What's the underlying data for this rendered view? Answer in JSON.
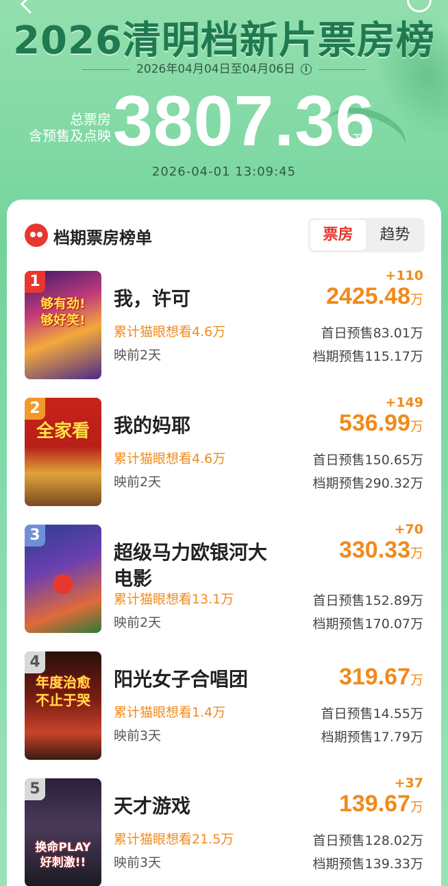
{
  "header": {
    "title": "2026清明档新片票房榜",
    "date_range": "2026年04月04日至04月06日",
    "total_label_line1": "总票房",
    "total_label_line2": "含预售及点映",
    "total_value": "3807.36",
    "total_unit": "万",
    "timestamp": "2026-04-01   13:09:45"
  },
  "section": {
    "title": "档期票房榜单",
    "tabs": [
      {
        "label": "票房",
        "active": true
      },
      {
        "label": "趋势",
        "active": false
      }
    ]
  },
  "movies": [
    {
      "rank": "1",
      "title": "我，许可",
      "want": "累计猫眼想看4.6万",
      "days": "映前2天",
      "delta": "+110",
      "amount": "2425.48",
      "unit": "万",
      "first_day": "首日预售83.01万",
      "period": "档期预售115.17万",
      "poster_text": "够有劲!\n够好笑!"
    },
    {
      "rank": "2",
      "title": "我的妈耶",
      "want": "累计猫眼想看4.6万",
      "days": "映前2天",
      "delta": "+149",
      "amount": "536.99",
      "unit": "万",
      "first_day": "首日预售150.65万",
      "period": "档期预售290.32万",
      "poster_text": "全家看"
    },
    {
      "rank": "3",
      "title": "超级马力欧银河大电影",
      "want": "累计猫眼想看13.1万",
      "days": "映前2天",
      "delta": "+70",
      "amount": "330.33",
      "unit": "万",
      "first_day": "首日预售152.89万",
      "period": "档期预售170.07万",
      "poster_text": ""
    },
    {
      "rank": "4",
      "title": "阳光女子合唱团",
      "want": "累计猫眼想看1.4万",
      "days": "映前3天",
      "delta": "",
      "amount": "319.67",
      "unit": "万",
      "first_day": "首日预售14.55万",
      "period": "档期预售17.79万",
      "poster_text": "年度治愈\n不止于哭"
    },
    {
      "rank": "5",
      "title": "天才游戏",
      "want": "累计猫眼想看21.5万",
      "days": "映前3天",
      "delta": "+37",
      "amount": "139.67",
      "unit": "万",
      "first_day": "首日预售128.02万",
      "period": "档期预售139.33万",
      "poster_text": "换命PLAY\n好刺激!!"
    }
  ],
  "colors": {
    "accent": "#f08a1c",
    "brand_red": "#e8372f",
    "hero_green": "#1f7a50"
  }
}
